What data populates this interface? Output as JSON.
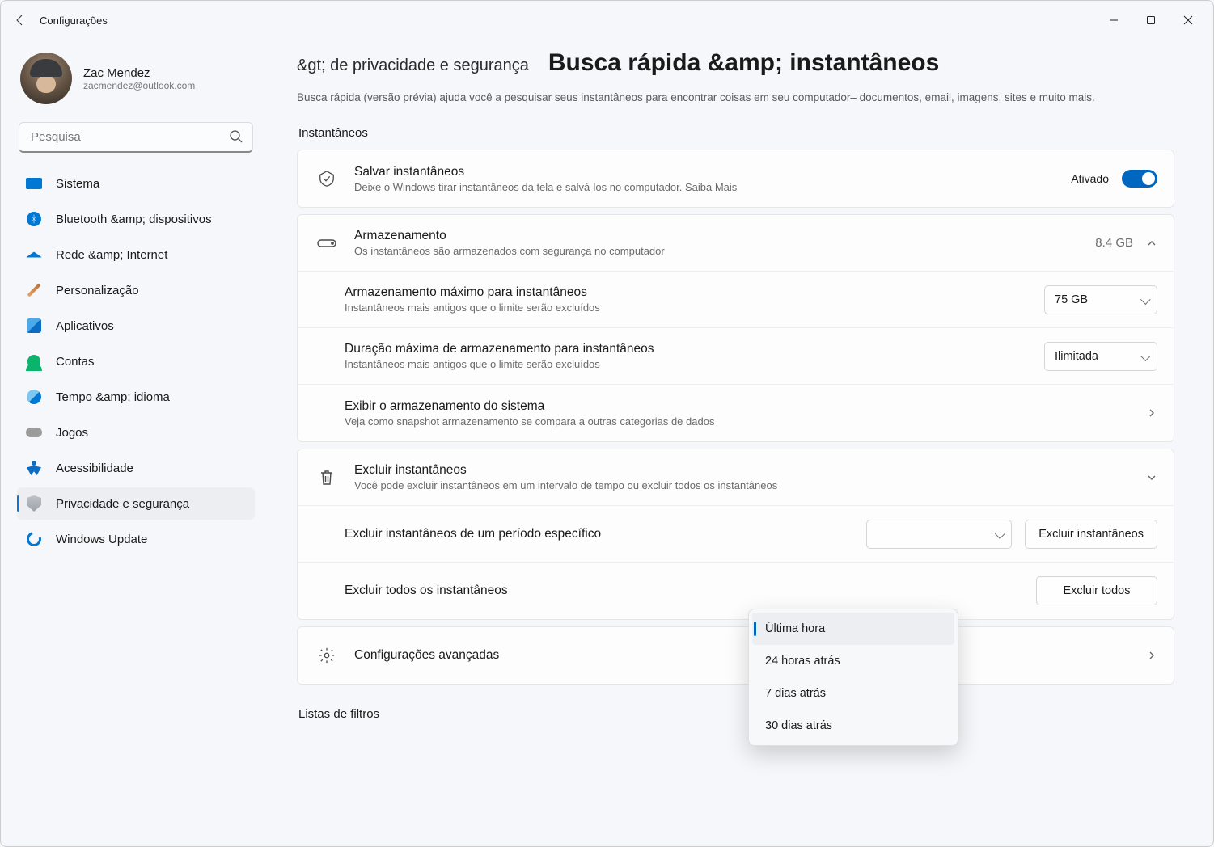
{
  "window": {
    "title": "Configurações"
  },
  "profile": {
    "name": "Zac Mendez",
    "email": "zacmendez@outlook.com"
  },
  "search": {
    "placeholder": "Pesquisa"
  },
  "nav": {
    "system": "Sistema",
    "bluetooth": "Bluetooth &amp; dispositivos",
    "network": "Rede &amp; Internet",
    "personalization": "Personalização",
    "apps": "Aplicativos",
    "accounts": "Contas",
    "time": "Tempo &amp; idioma",
    "games": "Jogos",
    "accessibility": "Acessibilidade",
    "privacy": "Privacidade e segurança",
    "update": "Windows Update"
  },
  "page": {
    "breadcrumb": "&gt; de privacidade e segurança",
    "title": "Busca rápida &amp; instantâneos",
    "subtitle": "Busca rápida (versão prévia) ajuda você a pesquisar seus instantâneos para encontrar coisas em seu computador– documentos, email, imagens, sites e muito mais.",
    "section_snapshots": "Instantâneos",
    "section_filters": "Listas de filtros"
  },
  "save_card": {
    "title": "Salvar instantâneos",
    "desc": "Deixe o Windows tirar instantâneos da tela e salvá-los no computador. Saiba Mais",
    "toggle_label": "Ativado"
  },
  "storage_card": {
    "title": "Armazenamento",
    "desc": "Os instantâneos são armazenados com segurança no computador",
    "value": "8.4 GB"
  },
  "max_storage": {
    "title": "Armazenamento máximo para instantâneos",
    "desc": "Instantâneos mais antigos que o limite serão excluídos",
    "selected": "75 GB"
  },
  "max_duration": {
    "title": "Duração máxima de armazenamento para instantâneos",
    "desc": "Instantâneos mais antigos que o limite serão excluídos",
    "selected": "Ilimitada"
  },
  "view_storage": {
    "title": "Exibir o armazenamento do sistema",
    "desc": "Veja como snapshot armazenamento se compara a outras categorias de dados"
  },
  "delete_card": {
    "title": "Excluir instantâneos",
    "desc": "Você pode excluir instantâneos em um intervalo de tempo ou excluir todos os instantâneos"
  },
  "delete_range": {
    "title": "Excluir instantâneos de um período específico",
    "button": "Excluir instantâneos",
    "options": [
      "Última hora",
      "24 horas atrás",
      "7 dias atrás",
      "30 dias atrás"
    ]
  },
  "delete_all": {
    "title": "Excluir todos os instantâneos",
    "button": "Excluir todos"
  },
  "advanced": {
    "title": "Configurações avançadas"
  }
}
